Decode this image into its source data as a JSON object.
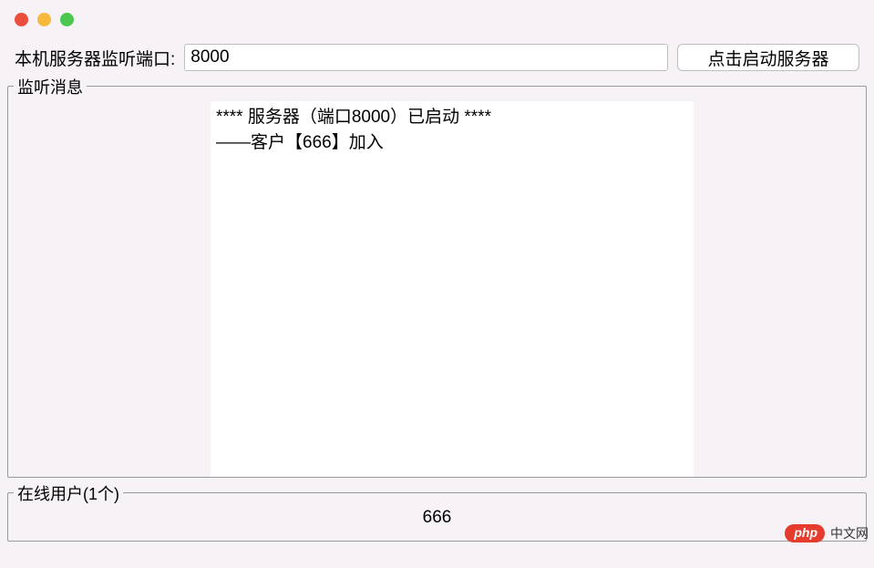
{
  "topbar": {
    "port_label": "本机服务器监听端口:",
    "port_value": "8000",
    "start_button": "点击启动服务器"
  },
  "listen": {
    "legend": "监听消息",
    "messages": "**** 服务器（端口8000）已启动 ****\n——客户【666】加入"
  },
  "users": {
    "legend": "在线用户(1个)",
    "items": [
      "666"
    ]
  },
  "watermark": {
    "badge": "php",
    "text": "中文网"
  }
}
